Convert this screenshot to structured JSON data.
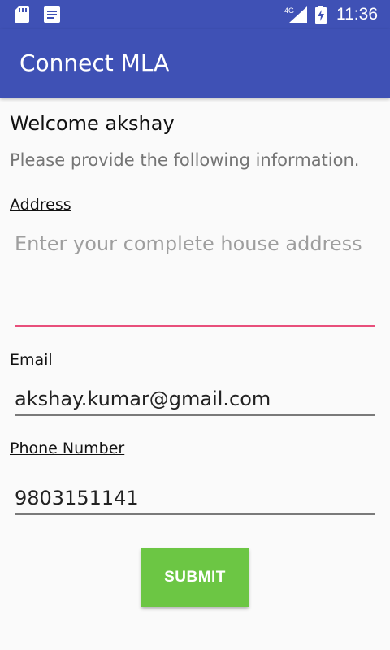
{
  "status_bar": {
    "time": "11:36",
    "network": "4G",
    "icons": [
      "sd-card-icon",
      "notification-note-icon",
      "signal-icon",
      "battery-charging-icon"
    ]
  },
  "app_bar": {
    "title": "Connect MLA",
    "color": "#3f51b5"
  },
  "content": {
    "welcome": "Welcome akshay",
    "instruction": "Please provide the following information."
  },
  "form": {
    "address": {
      "label": "Address",
      "placeholder": "Enter your complete house address",
      "value": ""
    },
    "email": {
      "label": "Email",
      "value": "akshay.kumar@gmail.com"
    },
    "phone": {
      "label": "Phone Number",
      "value": "9803151141"
    },
    "submit_label": "SUBMIT",
    "accent_color": "#e84f7b",
    "submit_color": "#6cc644"
  }
}
